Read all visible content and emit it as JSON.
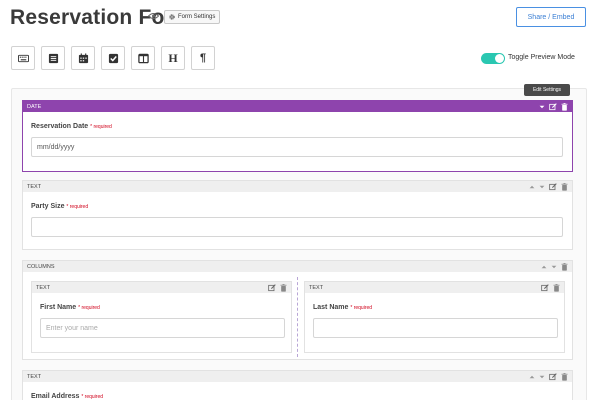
{
  "header": {
    "title": "Reservation Form",
    "eye_icon": "eye-icon",
    "form_settings_label": "Form Settings",
    "share_label": "Share / Embed"
  },
  "toolbar": {
    "tools": [
      "keyboard-icon",
      "list-icon",
      "calendar-icon",
      "checkbox-icon",
      "columns-icon",
      "heading-icon",
      "paragraph-icon"
    ],
    "heading_glyph": "H",
    "paragraph_glyph": "¶",
    "toggle_label": "Toggle Preview Mode",
    "toggle_on": true,
    "toggle_color": "#2ac7b1"
  },
  "tooltip": "Edit Settings",
  "fields": {
    "date": {
      "type_label": "DATE",
      "label": "Reservation Date",
      "required": "* required",
      "value": "mm/dd/yyyy",
      "accent": "#8e44ad"
    },
    "party": {
      "type_label": "TEXT",
      "label": "Party Size",
      "required": "* required",
      "value": ""
    },
    "columns": {
      "type_label": "COLUMNS",
      "first": {
        "type_label": "TEXT",
        "label": "First Name",
        "required": "* required",
        "placeholder": "Enter your name"
      },
      "last": {
        "type_label": "TEXT",
        "label": "Last Name",
        "required": "* required",
        "placeholder": ""
      }
    },
    "email": {
      "type_label": "TEXT",
      "label": "Email Address",
      "required": "* required"
    }
  }
}
